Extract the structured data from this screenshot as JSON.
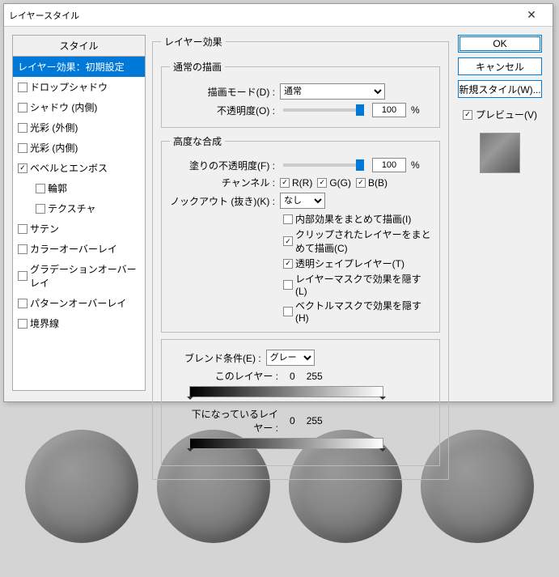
{
  "titlebar": {
    "title": "レイヤースタイル",
    "close": "✕"
  },
  "styleList": {
    "header": "スタイル",
    "items": [
      {
        "label": "レイヤー効果：初期設定",
        "selected": true,
        "checkbox": false,
        "checked": false,
        "indent": false
      },
      {
        "label": "ドロップシャドウ",
        "selected": false,
        "checkbox": true,
        "checked": false,
        "indent": false
      },
      {
        "label": "シャドウ (内側)",
        "selected": false,
        "checkbox": true,
        "checked": false,
        "indent": false
      },
      {
        "label": "光彩 (外側)",
        "selected": false,
        "checkbox": true,
        "checked": false,
        "indent": false
      },
      {
        "label": "光彩 (内側)",
        "selected": false,
        "checkbox": true,
        "checked": false,
        "indent": false
      },
      {
        "label": "ベベルとエンボス",
        "selected": false,
        "checkbox": true,
        "checked": true,
        "indent": false
      },
      {
        "label": "輪郭",
        "selected": false,
        "checkbox": true,
        "checked": false,
        "indent": true
      },
      {
        "label": "テクスチャ",
        "selected": false,
        "checkbox": true,
        "checked": false,
        "indent": true
      },
      {
        "label": "サテン",
        "selected": false,
        "checkbox": true,
        "checked": false,
        "indent": false
      },
      {
        "label": "カラーオーバーレイ",
        "selected": false,
        "checkbox": true,
        "checked": false,
        "indent": false
      },
      {
        "label": "グラデーションオーバーレイ",
        "selected": false,
        "checkbox": true,
        "checked": false,
        "indent": false
      },
      {
        "label": "パターンオーバーレイ",
        "selected": false,
        "checkbox": true,
        "checked": false,
        "indent": false
      },
      {
        "label": "境界線",
        "selected": false,
        "checkbox": true,
        "checked": false,
        "indent": false
      }
    ]
  },
  "layerEffect": {
    "groupLabel": "レイヤー効果",
    "blendingGroup": "通常の描画",
    "blendMode": {
      "label": "描画モード(D) :",
      "value": "通常"
    },
    "opacity": {
      "label": "不透明度(O) :",
      "value": "100",
      "unit": "%"
    }
  },
  "advanced": {
    "groupLabel": "高度な合成",
    "fillOpacity": {
      "label": "塗りの不透明度(F) :",
      "value": "100",
      "unit": "%"
    },
    "channels": {
      "label": "チャンネル :",
      "r": "R(R)",
      "g": "G(G)",
      "b": "B(B)"
    },
    "knockout": {
      "label": "ノックアウト (抜き)(K) :",
      "value": "なし"
    },
    "checks": [
      {
        "label": "内部効果をまとめて描画(I)",
        "checked": false
      },
      {
        "label": "クリップされたレイヤーをまとめて描画(C)",
        "checked": true
      },
      {
        "label": "透明シェイプレイヤー(T)",
        "checked": true
      },
      {
        "label": "レイヤーマスクで効果を隠す(L)",
        "checked": false
      },
      {
        "label": "ベクトルマスクで効果を隠す(H)",
        "checked": false
      }
    ]
  },
  "blendIf": {
    "label": "ブレンド条件(E) :",
    "value": "グレー",
    "thisLayer": {
      "label": "このレイヤー :",
      "low": "0",
      "high": "255"
    },
    "underLayer": {
      "label": "下になっているレイヤー :",
      "low": "0",
      "high": "255"
    }
  },
  "buttons": {
    "ok": "OK",
    "cancel": "キャンセル",
    "newStyle": "新規スタイル(W)...",
    "preview": "プレビュー(V)"
  }
}
